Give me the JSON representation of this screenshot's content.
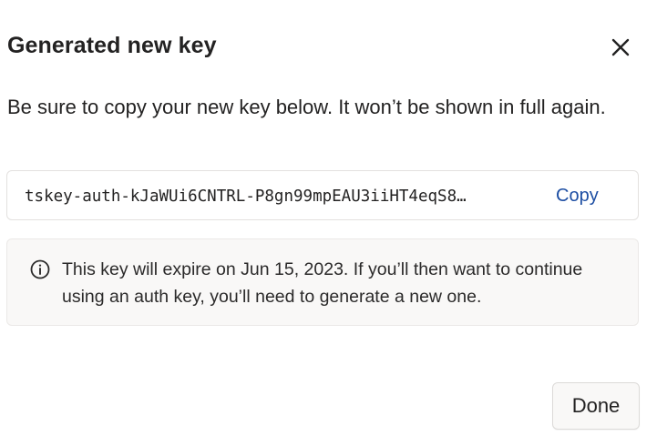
{
  "dialog": {
    "title": "Generated new key",
    "close_icon": "close-icon",
    "description": "Be sure to copy your new key below. It won’t be shown in full again.",
    "key": {
      "value": "tskey-auth-kJaWUi6CNTRL-P8gn99mpEAU3iiHT4eqS8…",
      "copy_label": "Copy"
    },
    "notice": {
      "icon": "info-icon",
      "text": "This key will expire on Jun 15, 2023. If you’ll then want to continue using an auth key, you’ll need to generate a new one."
    },
    "done_label": "Done"
  },
  "colors": {
    "link_blue": "#1d4ea3",
    "notice_background": "#f9f8f7",
    "border": "#e3e1df",
    "text": "#232222"
  }
}
